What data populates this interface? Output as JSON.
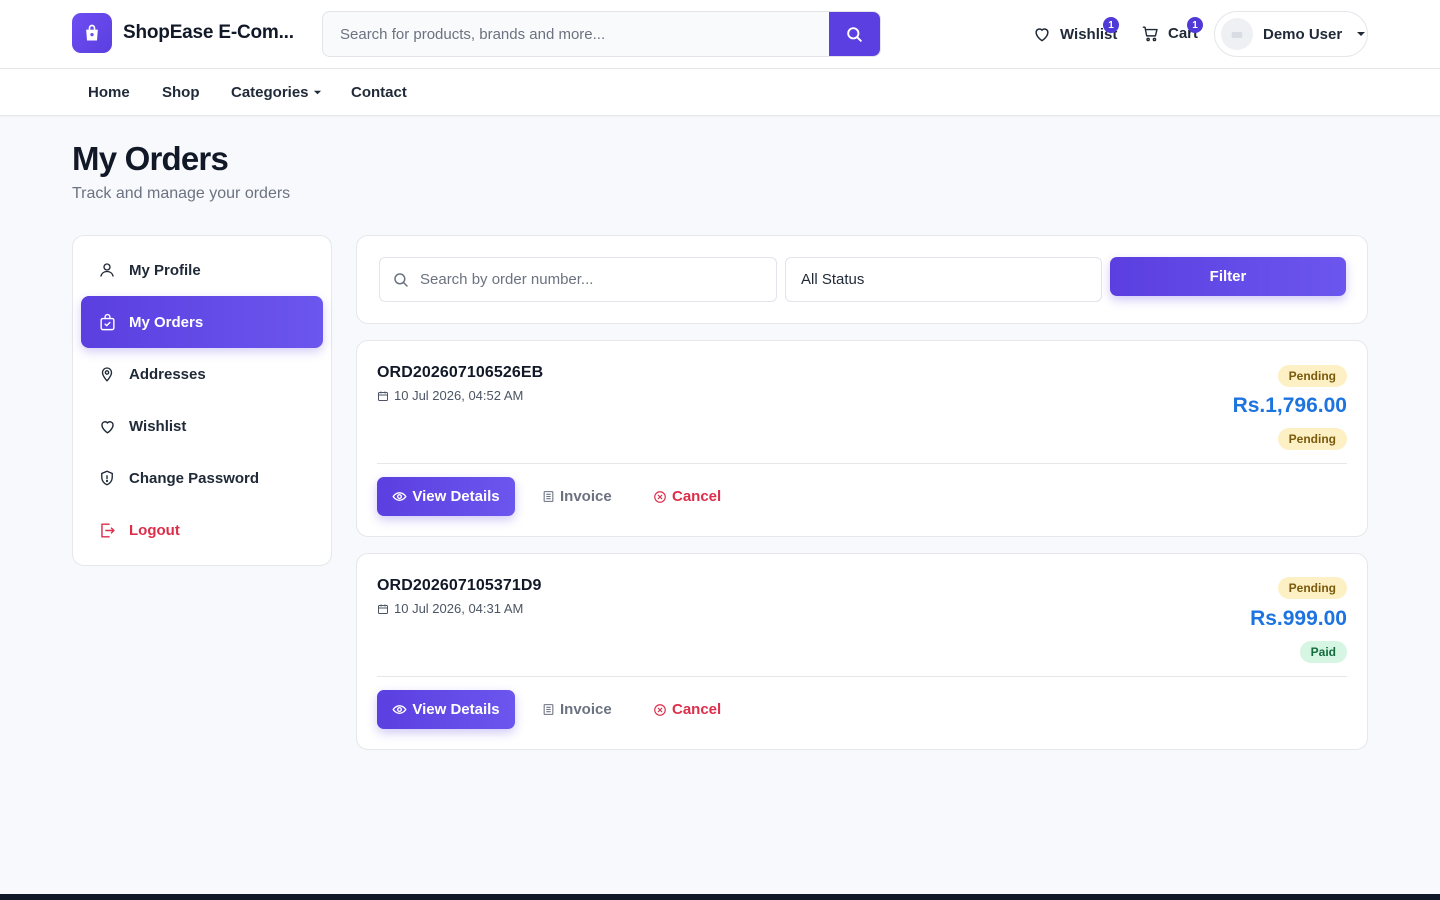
{
  "header": {
    "brand": "ShopEase E-Com...",
    "search_placeholder": "Search for products, brands and more...",
    "wishlist_label": "Wishlist",
    "wishlist_count": "1",
    "cart_label": "Cart",
    "cart_count": "1",
    "user_name": "Demo User"
  },
  "nav": {
    "items": [
      "Home",
      "Shop",
      "Categories",
      "Contact"
    ]
  },
  "page": {
    "title": "My Orders",
    "subtitle": "Track and manage your orders"
  },
  "sidebar": {
    "items": [
      {
        "label": "My Profile",
        "icon": "user-icon"
      },
      {
        "label": "My Orders",
        "icon": "shopping-bag-icon",
        "active": true
      },
      {
        "label": "Addresses",
        "icon": "map-pin-icon"
      },
      {
        "label": "Wishlist",
        "icon": "heart-icon"
      },
      {
        "label": "Change Password",
        "icon": "shield-icon"
      },
      {
        "label": "Logout",
        "icon": "logout-icon"
      }
    ]
  },
  "filters": {
    "search_placeholder": "Search by order number...",
    "status_value": "All Status",
    "filter_label": "Filter"
  },
  "orders": [
    {
      "number": "ORD202607106526EB",
      "date": "10 Jul 2026, 04:52 AM",
      "status": "Pending",
      "amount": "Rs.1,796.00",
      "payment_status": "Pending"
    },
    {
      "number": "ORD202607105371D9",
      "date": "10 Jul 2026, 04:31 AM",
      "status": "Pending",
      "amount": "Rs.999.00",
      "payment_status": "Paid"
    }
  ],
  "actions": {
    "view_details": "View Details",
    "invoice": "Invoice",
    "cancel": "Cancel"
  },
  "colors": {
    "accent": "#5b3fe0",
    "amount": "#1d74e0",
    "danger": "#dc2e4a",
    "pending_bg": "#fdf0c4",
    "paid_bg": "#d6f5e3"
  }
}
